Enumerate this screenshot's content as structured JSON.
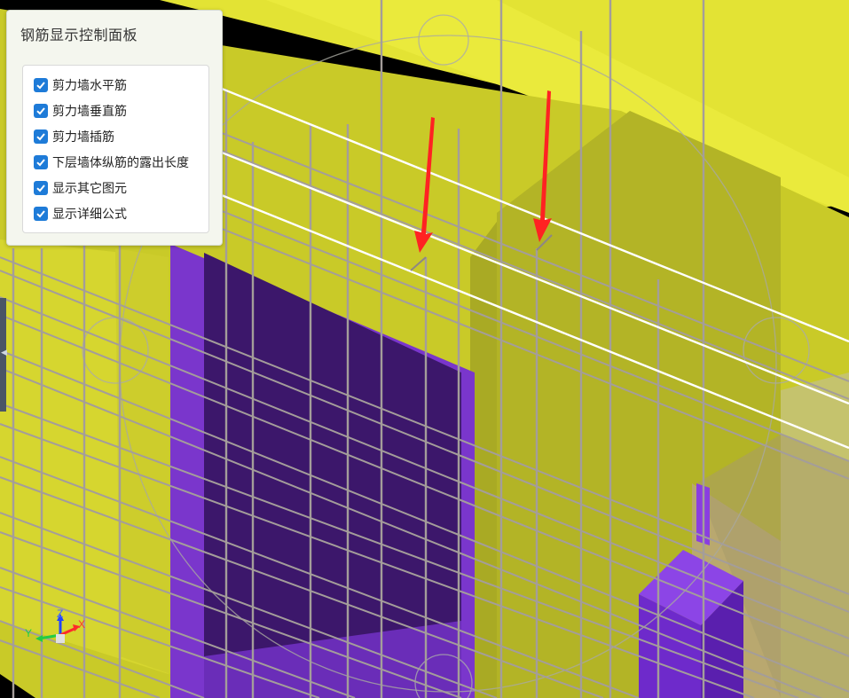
{
  "panel": {
    "title": "钢筋显示控制面板",
    "options": [
      {
        "label": "剪力墙水平筋",
        "checked": true
      },
      {
        "label": "剪力墙垂直筋",
        "checked": true
      },
      {
        "label": "剪力墙插筋",
        "checked": true
      },
      {
        "label": "下层墙体纵筋的露出长度",
        "checked": true
      },
      {
        "label": "显示其它图元",
        "checked": true
      },
      {
        "label": "显示详细公式",
        "checked": true
      }
    ]
  },
  "axes": {
    "x": "X",
    "y": "Y",
    "z": "Z"
  },
  "colors": {
    "wall": "#c8c927",
    "wall_top": "#e5e535",
    "opening": "#3f1a6e",
    "opening_frame": "#7c3bd1",
    "rebar": "#a09a97",
    "highlight_rebar": "#ffffff",
    "arrow": "#ff2020"
  }
}
